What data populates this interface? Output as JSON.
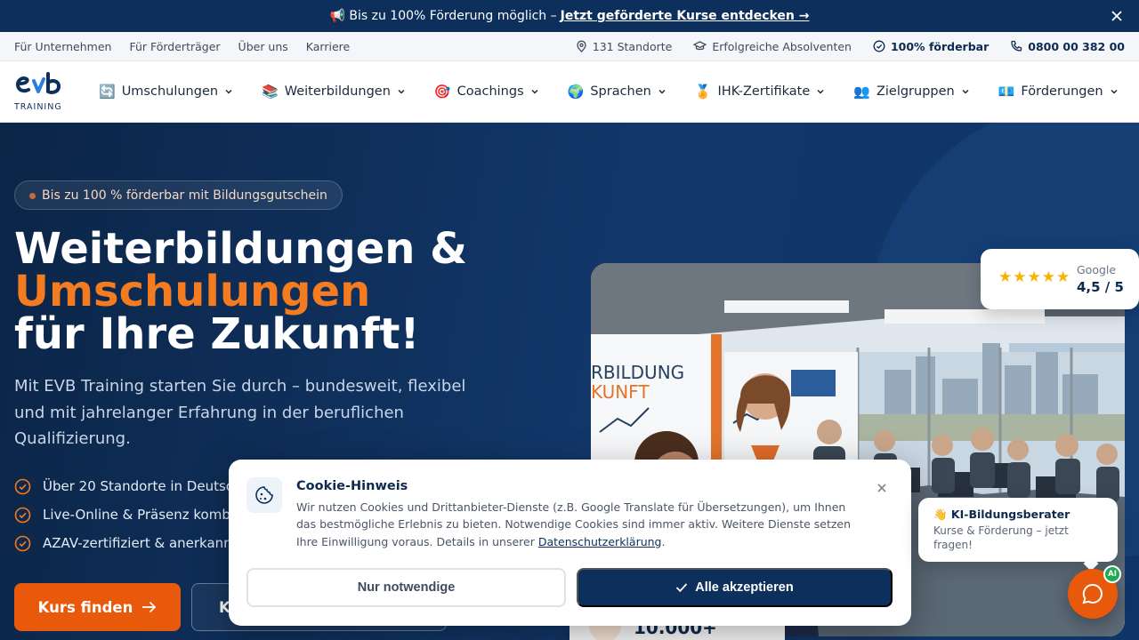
{
  "promo": {
    "text": "📢 Bis zu 100% Förderung möglich –",
    "link": "Jetzt geförderte Kurse entdecken →"
  },
  "utility": {
    "left": [
      "Für Unternehmen",
      "Für Förderträger",
      "Über uns",
      "Karriere"
    ],
    "locations": "131 Standorte",
    "graduates": "Erfolgreiche Absolventen",
    "funding": "100% förderbar",
    "phone": "0800 00 382 00"
  },
  "logo": {
    "sub": "TRAINING"
  },
  "nav": [
    {
      "emoji": "🔄",
      "label": "Umschulungen"
    },
    {
      "emoji": "📚",
      "label": "Weiterbildungen"
    },
    {
      "emoji": "🎯",
      "label": "Coachings"
    },
    {
      "emoji": "🌍",
      "label": "Sprachen"
    },
    {
      "emoji": "🏅",
      "label": "IHK-Zertifikate"
    },
    {
      "emoji": "👥",
      "label": "Zielgruppen"
    },
    {
      "emoji": "💶",
      "label": "Förderungen"
    }
  ],
  "hero": {
    "badge": "Bis zu 100 % förderbar mit Bildungsgutschein",
    "title_line1": "Weiterbildungen &",
    "title_line2": "Umschulungen",
    "title_line3": "für Ihre Zukunft!",
    "lead": "Mit EVB Training starten Sie durch – bundesweit, flexibel und mit jahrelanger Erfahrung in der beruflichen Qualifizierung.",
    "checks": [
      "Über 20 Standorte in Deutschland",
      "Live-Online & Präsenz kombinierbar",
      "AZAV-zertifiziert & anerkannt"
    ],
    "cta_primary": "Kurs finden",
    "cta_secondary": "K"
  },
  "rating": {
    "stars": "★★★★★",
    "source": "Google",
    "score": "4,5 / 5"
  },
  "stat": {
    "value": "10.000+"
  },
  "cookie": {
    "title": "Cookie-Hinweis",
    "text": "Wir nutzen Cookies und Drittanbieter-Dienste (z.B. Google Translate für Übersetzungen), um Ihnen das bestmögliche Erlebnis zu bieten. Notwendige Cookies sind immer aktiv. Weitere Dienste setzen Ihre Einwilligung voraus. Details in unserer",
    "link": "Datenschutzerklärung",
    "button_necessary": "Nur notwendige",
    "button_all": "Alle akzeptieren"
  },
  "chat": {
    "title": "👋 KI-Bildungsberater",
    "subtitle": "Kurse & Förderung – jetzt fragen!",
    "badge": "AI"
  },
  "colors": {
    "navy": "#0d2f5c",
    "orange": "#e8590c",
    "accent_orange_text": "#f47b20",
    "star": "#f4b400"
  }
}
